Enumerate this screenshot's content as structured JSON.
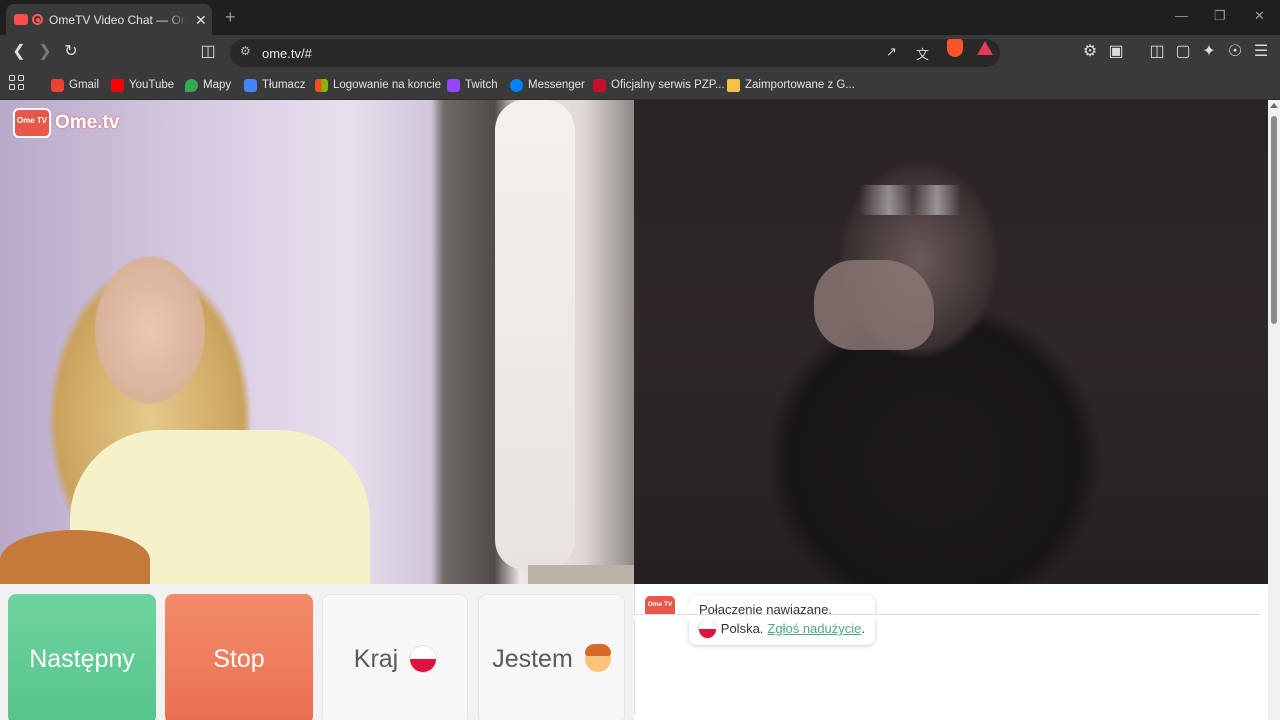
{
  "browser": {
    "tab_title": "OmeTV Video Chat — Omegle",
    "tab_close": "✕",
    "new_tab": "+",
    "url": "ome.tv/#",
    "window_controls": [
      "—",
      "❐",
      "✕"
    ]
  },
  "bookmarks": [
    {
      "label": "Gmail",
      "icon_color": "#ea4335"
    },
    {
      "label": "YouTube",
      "icon_color": "#ff0000"
    },
    {
      "label": "Mapy",
      "icon_color": "#34a853"
    },
    {
      "label": "Tłumacz",
      "icon_color": "#4285f4"
    },
    {
      "label": "Logowanie na koncie",
      "icon_color": "#f25022"
    },
    {
      "label": "Twitch",
      "icon_color": "#9146ff"
    },
    {
      "label": "Messenger",
      "icon_color": "#0084ff"
    },
    {
      "label": "Oficjalny serwis PZP...",
      "icon_color": "#c8102e"
    },
    {
      "label": "Zaimportowane z G...",
      "icon_color": "#f5c242"
    }
  ],
  "site": {
    "logo_badge": "Ome TV",
    "logo_text": "Ome.tv"
  },
  "controls": {
    "next": "Następny",
    "stop": "Stop",
    "country": "Kraj",
    "gender": "Jestem"
  },
  "chat": {
    "logo_badge": "Ome TV",
    "connected": "Połączenie nawiązane.",
    "country": "Polska.",
    "report": "Zgłoś nadużycie",
    "period": "."
  },
  "colors": {
    "next_button": "#56c48b",
    "stop_button": "#ea6f52",
    "brand_red": "#e8584a",
    "report_link": "#4aa97d"
  }
}
